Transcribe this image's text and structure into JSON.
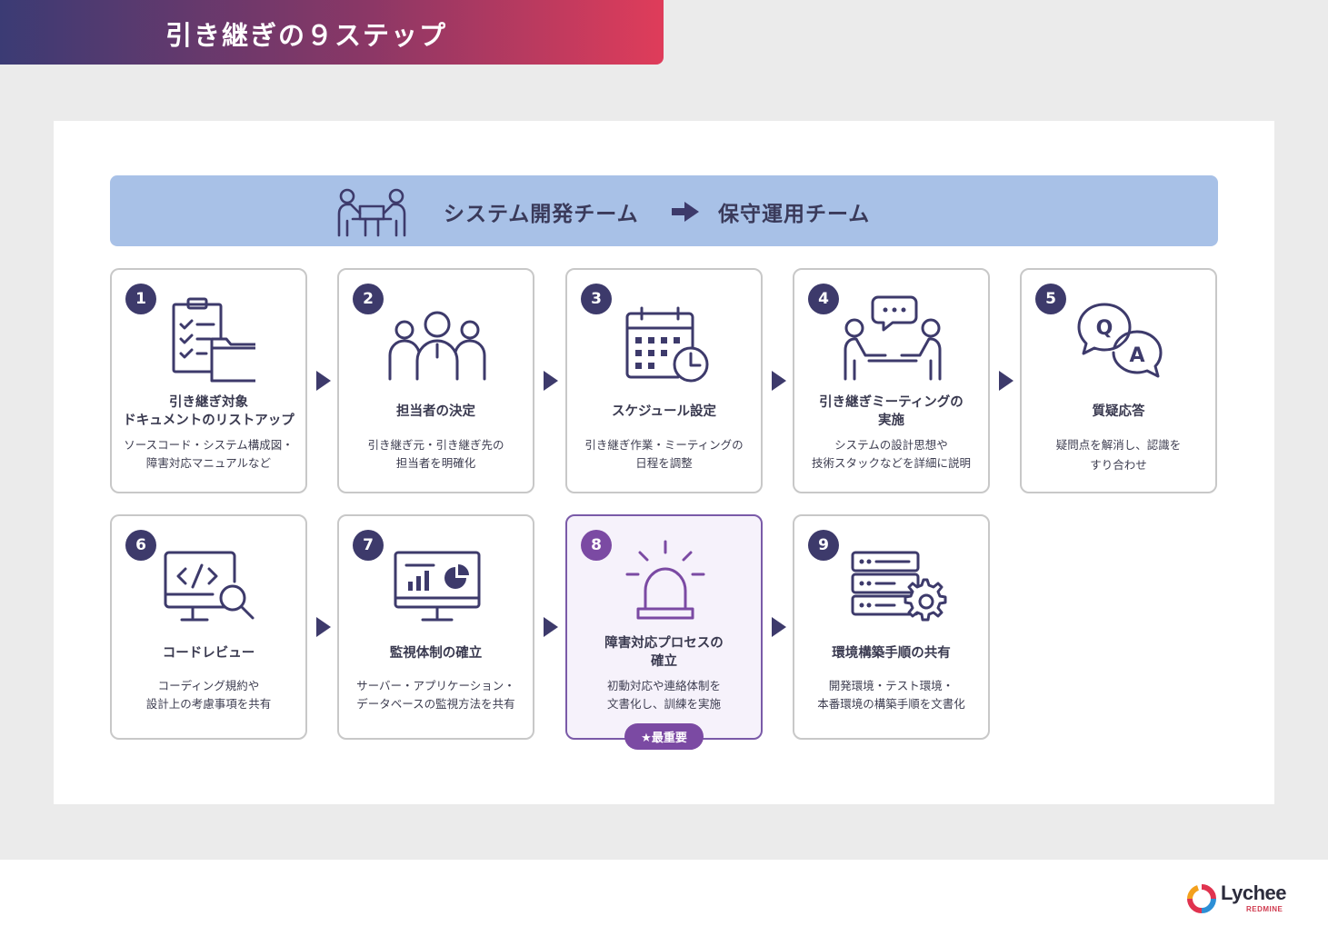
{
  "title": "引き継ぎの９ステップ",
  "team_bar": {
    "from": "システム開発チーム",
    "to": "保守運用チーム",
    "icon": "people-meeting-icon",
    "arrow_icon": "arrow-right-icon"
  },
  "steps": [
    {
      "number": "1",
      "title_lines": [
        "引き継ぎ対象",
        "ドキュメントのリストアップ"
      ],
      "desc_lines": [
        "ソースコード・システム構成図・",
        "障害対応マニュアルなど"
      ],
      "icon": "checklist-folder-icon"
    },
    {
      "number": "2",
      "title_lines": [
        "担当者の決定"
      ],
      "desc_lines": [
        "引き継ぎ元・引き継ぎ先の",
        "担当者を明確化"
      ],
      "icon": "team-icon"
    },
    {
      "number": "3",
      "title_lines": [
        "スケジュール設定"
      ],
      "desc_lines": [
        "引き継ぎ作業・ミーティングの",
        "日程を調整"
      ],
      "icon": "calendar-clock-icon"
    },
    {
      "number": "4",
      "title_lines": [
        "引き継ぎミーティングの",
        "実施"
      ],
      "desc_lines": [
        "システムの設計思想や",
        "技術スタックなどを詳細に説明"
      ],
      "icon": "meeting-chat-icon"
    },
    {
      "number": "5",
      "title_lines": [
        "質疑応答"
      ],
      "desc_lines": [
        "疑問点を解消し、認識を",
        "すり合わせ"
      ],
      "icon": "qa-bubbles-icon"
    },
    {
      "number": "6",
      "title_lines": [
        "コードレビュー"
      ],
      "desc_lines": [
        "コーディング規約や",
        "設計上の考慮事項を共有"
      ],
      "icon": "code-review-icon"
    },
    {
      "number": "7",
      "title_lines": [
        "監視体制の確立"
      ],
      "desc_lines": [
        "サーバー・アプリケーション・",
        "データベースの監視方法を共有"
      ],
      "icon": "monitor-dashboard-icon"
    },
    {
      "number": "8",
      "title_lines": [
        "障害対応プロセスの",
        "確立"
      ],
      "desc_lines": [
        "初動対応や連絡体制を",
        "文書化し、訓練を実施"
      ],
      "icon": "alarm-light-icon",
      "highlight": true,
      "badge": "★最重要"
    },
    {
      "number": "9",
      "title_lines": [
        "環境構築手順の共有"
      ],
      "desc_lines": [
        "開発環境・テスト環境・",
        "本番環境の構築手順を文書化"
      ],
      "icon": "server-gear-icon"
    }
  ],
  "colors": {
    "navy": "#3d3a6b",
    "purple": "#7b4aa3",
    "bar": "#a8c1e7",
    "gradient_start": "#3b3b74",
    "gradient_end": "#df3c5a"
  },
  "logo": {
    "word": "Lychee",
    "sub": "REDMINE"
  }
}
